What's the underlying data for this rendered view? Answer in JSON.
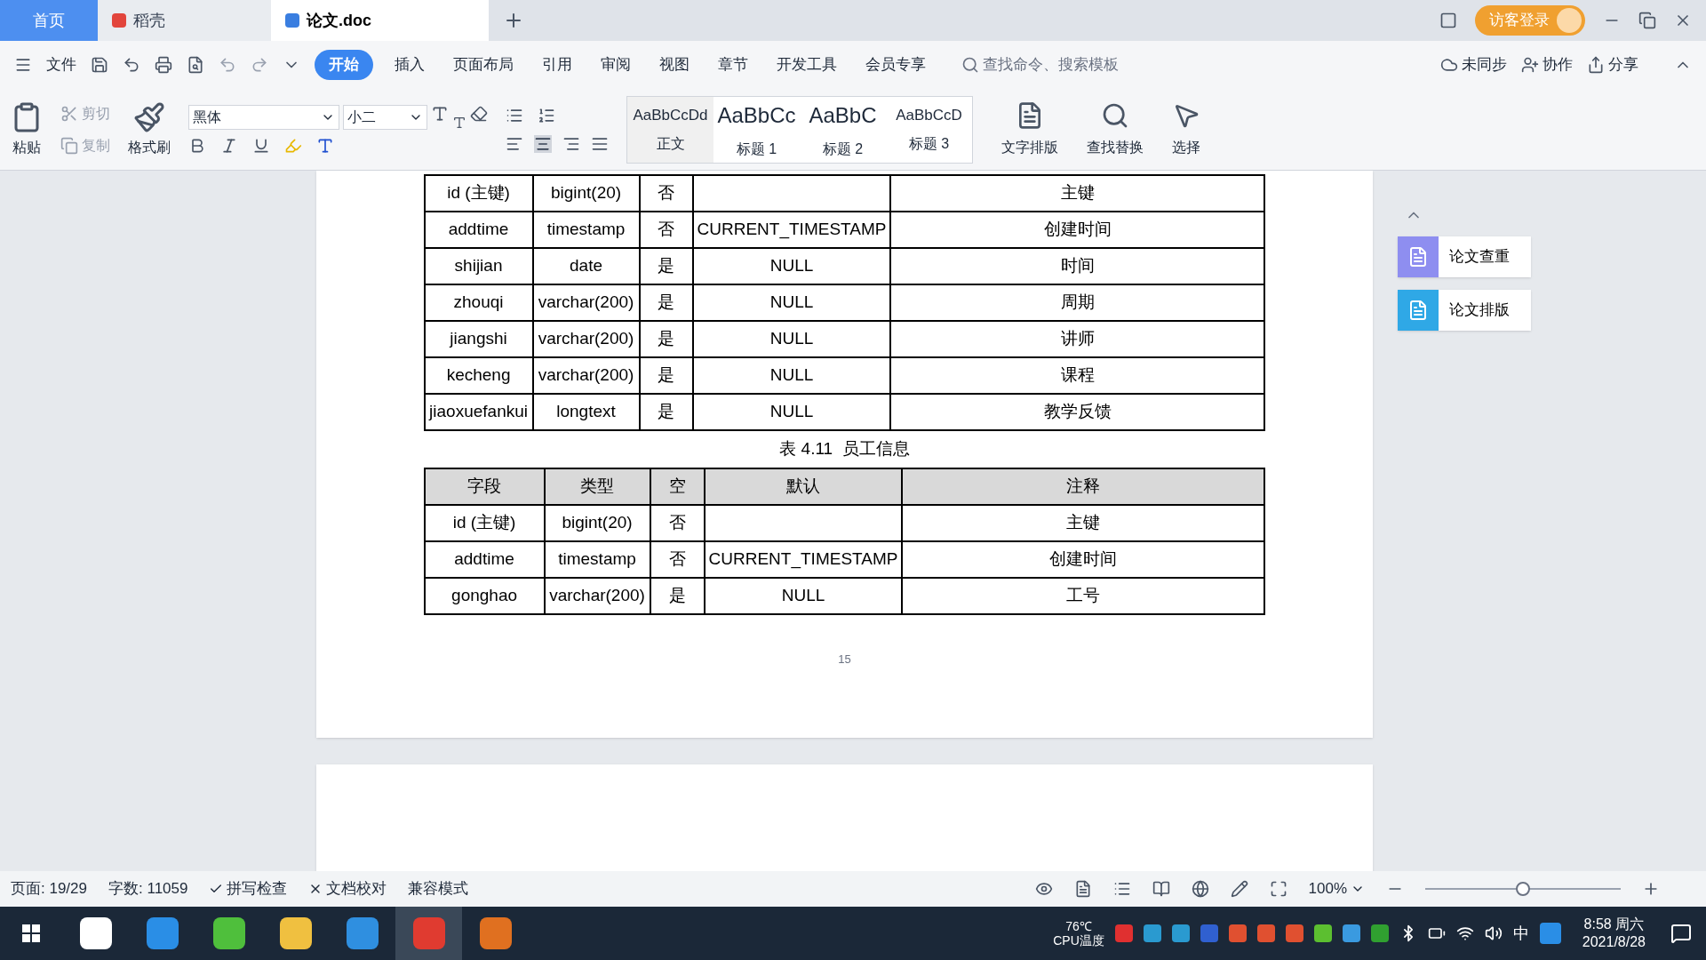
{
  "tabs": [
    {
      "label": "首页",
      "kind": "home",
      "selected": false
    },
    {
      "label": "稻壳",
      "kind": "docer",
      "selected": false
    },
    {
      "label": "论文.doc",
      "kind": "doc",
      "selected": true
    }
  ],
  "guest_login": "访客登录",
  "menu": [
    {
      "label": "文件",
      "selected": false
    },
    {
      "label": "开始",
      "selected": true
    },
    {
      "label": "插入",
      "selected": false
    },
    {
      "label": "页面布局",
      "selected": false
    },
    {
      "label": "引用",
      "selected": false
    },
    {
      "label": "审阅",
      "selected": false
    },
    {
      "label": "视图",
      "selected": false
    },
    {
      "label": "章节",
      "selected": false
    },
    {
      "label": "开发工具",
      "selected": false
    },
    {
      "label": "会员专享",
      "selected": false
    }
  ],
  "search": {
    "placeholder": "查找命令、搜索模板"
  },
  "menu_actions": [
    "未同步",
    "协作",
    "分享"
  ],
  "ribbon": {
    "paste": "粘贴",
    "cut": "剪切",
    "copy": "复制",
    "format_painter": "格式刷",
    "font": "黑体",
    "font_size": "小二",
    "styles": [
      {
        "preview": "AaBbCcDd",
        "label": "正文"
      },
      {
        "preview": "AaBbCc",
        "label": "标题 1"
      },
      {
        "preview": "AaBbC",
        "label": "标题 2"
      },
      {
        "preview": "AaBbCcD",
        "label": "标题 3"
      }
    ],
    "tools": [
      "文字排版",
      "查找替换",
      "选择"
    ]
  },
  "document": {
    "tables": [
      {
        "rows": [
          [
            "id (主键)",
            "bigint(20)",
            "否",
            "",
            "主键"
          ],
          [
            "addtime",
            "timestamp",
            "否",
            "CURRENT_TIMESTAMP",
            "创建时间"
          ],
          [
            "shijian",
            "date",
            "是",
            "NULL",
            "时间"
          ],
          [
            "zhouqi",
            "varchar(200)",
            "是",
            "NULL",
            "周期"
          ],
          [
            "jiangshi",
            "varchar(200)",
            "是",
            "NULL",
            "讲师"
          ],
          [
            "kecheng",
            "varchar(200)",
            "是",
            "NULL",
            "课程"
          ],
          [
            "jiaoxuefankui",
            "longtext",
            "是",
            "NULL",
            "教学反馈"
          ]
        ]
      },
      {
        "caption": "表 4.11  员工信息",
        "header": [
          "字段",
          "类型",
          "空",
          "默认",
          "注释"
        ],
        "rows": [
          [
            "id (主键)",
            "bigint(20)",
            "否",
            "",
            "主键"
          ],
          [
            "addtime",
            "timestamp",
            "否",
            "CURRENT_TIMESTAMP",
            "创建时间"
          ],
          [
            "gonghao",
            "varchar(200)",
            "是",
            "NULL",
            "工号"
          ]
        ]
      }
    ],
    "page_number": "15"
  },
  "side_panel": [
    "论文查重",
    "论文排版"
  ],
  "status_bar": {
    "page": "页面: 19/29",
    "words": "字数: 11059",
    "spell_check": "拼写检查",
    "proofread": "文档校对",
    "mode": "兼容模式",
    "zoom": "100%",
    "zoom_slider": {
      "level": 0.5
    }
  },
  "taskbar": {
    "cpu_temp": "76℃",
    "cpu_label": "CPU温度",
    "ime": "中",
    "time": "8:58 周六",
    "date": "2021/8/28"
  }
}
